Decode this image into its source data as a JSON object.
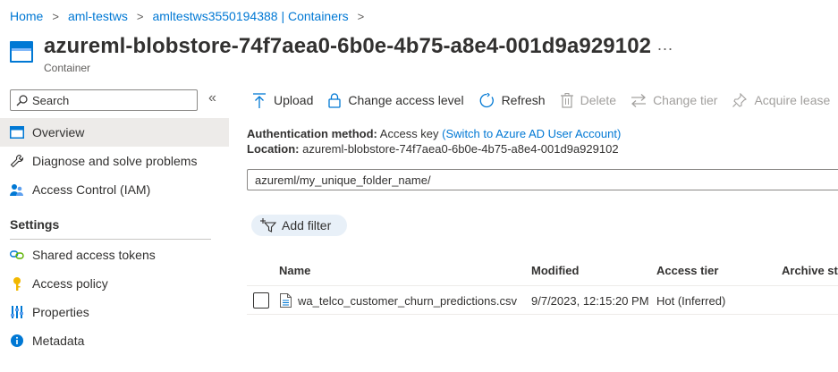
{
  "breadcrumb": [
    "Home",
    "aml-testws",
    "amltestws3550194388 | Containers"
  ],
  "header": {
    "title": "azureml-blobstore-74f7aea0-6b0e-4b75-a8e4-001d9a929102",
    "subtitle": "Container",
    "more": "..."
  },
  "sidebar": {
    "search_placeholder": "Search",
    "collapse": "«",
    "items": [
      {
        "label": "Overview",
        "icon": "container-icon",
        "active": true
      },
      {
        "label": "Diagnose and solve problems",
        "icon": "wrench-icon"
      },
      {
        "label": "Access Control (IAM)",
        "icon": "people-icon"
      }
    ],
    "settings_title": "Settings",
    "settings_items": [
      {
        "label": "Shared access tokens",
        "icon": "link-icon"
      },
      {
        "label": "Access policy",
        "icon": "key-icon"
      },
      {
        "label": "Properties",
        "icon": "properties-icon"
      },
      {
        "label": "Metadata",
        "icon": "info-icon"
      }
    ]
  },
  "toolbar": {
    "upload": "Upload",
    "change_access": "Change access level",
    "refresh": "Refresh",
    "delete": "Delete",
    "change_tier": "Change tier",
    "acquire_lease": "Acquire lease"
  },
  "details": {
    "auth_label": "Authentication method:",
    "auth_value": "Access key",
    "auth_link": "(Switch to Azure AD User Account)",
    "location_label": "Location:",
    "location_value": "azureml-blobstore-74f7aea0-6b0e-4b75-a8e4-001d9a929102"
  },
  "path": "azureml/my_unique_folder_name/",
  "filter_label": "Add filter",
  "table": {
    "columns": [
      "Name",
      "Modified",
      "Access tier",
      "Archive sta"
    ],
    "rows": [
      {
        "name": "wa_telco_customer_churn_predictions.csv",
        "modified": "9/7/2023, 12:15:20 PM",
        "tier": "Hot (Inferred)",
        "archive": ""
      }
    ]
  },
  "colors": {
    "accent": "#0078d4",
    "active_bg": "#edebe9",
    "filter_bg": "#e8f0f8"
  }
}
